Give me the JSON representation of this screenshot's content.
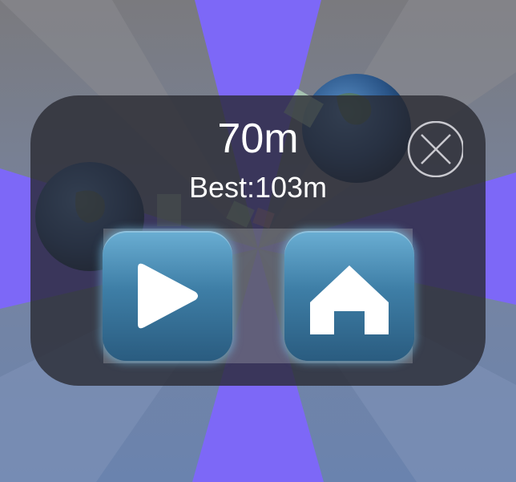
{
  "game_over": {
    "distance": "70m",
    "best": "Best:103m"
  },
  "icons": {
    "close": "close-circle-icon",
    "play": "play-icon",
    "home": "home-icon"
  },
  "colors": {
    "background_purple": "#7a66f5",
    "background_gray": "#6f7c9a",
    "dialog": "#28282f",
    "button_blue": "#3e7ea6"
  }
}
